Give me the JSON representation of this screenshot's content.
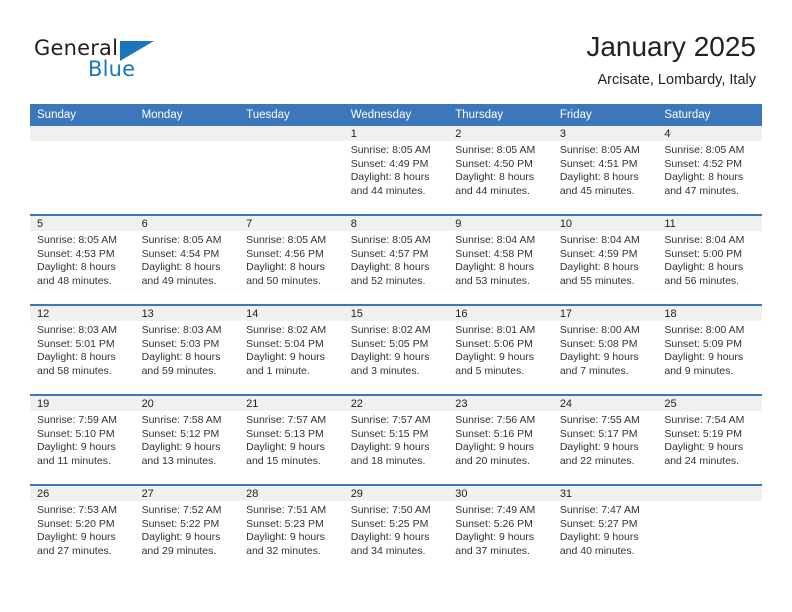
{
  "brand": {
    "line1": "General",
    "line2": "Blue",
    "flag_icon": "triangle-flag-icon",
    "accent_color": "#1b75bb"
  },
  "header": {
    "title": "January 2025",
    "subtitle": "Arcisate, Lombardy, Italy"
  },
  "theme": {
    "header_row_bg": "#3b77ba",
    "daynum_band_bg": "#f0f0f0",
    "row_divider": "#3b77ba"
  },
  "calendar": {
    "weekday_headers": [
      "Sunday",
      "Monday",
      "Tuesday",
      "Wednesday",
      "Thursday",
      "Friday",
      "Saturday"
    ],
    "weeks": [
      [
        {
          "day": "",
          "empty": true,
          "sunrise": "",
          "sunset": "",
          "daylight1": "",
          "daylight2": ""
        },
        {
          "day": "",
          "empty": true,
          "sunrise": "",
          "sunset": "",
          "daylight1": "",
          "daylight2": ""
        },
        {
          "day": "",
          "empty": true,
          "sunrise": "",
          "sunset": "",
          "daylight1": "",
          "daylight2": ""
        },
        {
          "day": "1",
          "empty": false,
          "sunrise": "Sunrise: 8:05 AM",
          "sunset": "Sunset: 4:49 PM",
          "daylight1": "Daylight: 8 hours",
          "daylight2": "and 44 minutes."
        },
        {
          "day": "2",
          "empty": false,
          "sunrise": "Sunrise: 8:05 AM",
          "sunset": "Sunset: 4:50 PM",
          "daylight1": "Daylight: 8 hours",
          "daylight2": "and 44 minutes."
        },
        {
          "day": "3",
          "empty": false,
          "sunrise": "Sunrise: 8:05 AM",
          "sunset": "Sunset: 4:51 PM",
          "daylight1": "Daylight: 8 hours",
          "daylight2": "and 45 minutes."
        },
        {
          "day": "4",
          "empty": false,
          "sunrise": "Sunrise: 8:05 AM",
          "sunset": "Sunset: 4:52 PM",
          "daylight1": "Daylight: 8 hours",
          "daylight2": "and 47 minutes."
        }
      ],
      [
        {
          "day": "5",
          "empty": false,
          "sunrise": "Sunrise: 8:05 AM",
          "sunset": "Sunset: 4:53 PM",
          "daylight1": "Daylight: 8 hours",
          "daylight2": "and 48 minutes."
        },
        {
          "day": "6",
          "empty": false,
          "sunrise": "Sunrise: 8:05 AM",
          "sunset": "Sunset: 4:54 PM",
          "daylight1": "Daylight: 8 hours",
          "daylight2": "and 49 minutes."
        },
        {
          "day": "7",
          "empty": false,
          "sunrise": "Sunrise: 8:05 AM",
          "sunset": "Sunset: 4:56 PM",
          "daylight1": "Daylight: 8 hours",
          "daylight2": "and 50 minutes."
        },
        {
          "day": "8",
          "empty": false,
          "sunrise": "Sunrise: 8:05 AM",
          "sunset": "Sunset: 4:57 PM",
          "daylight1": "Daylight: 8 hours",
          "daylight2": "and 52 minutes."
        },
        {
          "day": "9",
          "empty": false,
          "sunrise": "Sunrise: 8:04 AM",
          "sunset": "Sunset: 4:58 PM",
          "daylight1": "Daylight: 8 hours",
          "daylight2": "and 53 minutes."
        },
        {
          "day": "10",
          "empty": false,
          "sunrise": "Sunrise: 8:04 AM",
          "sunset": "Sunset: 4:59 PM",
          "daylight1": "Daylight: 8 hours",
          "daylight2": "and 55 minutes."
        },
        {
          "day": "11",
          "empty": false,
          "sunrise": "Sunrise: 8:04 AM",
          "sunset": "Sunset: 5:00 PM",
          "daylight1": "Daylight: 8 hours",
          "daylight2": "and 56 minutes."
        }
      ],
      [
        {
          "day": "12",
          "empty": false,
          "sunrise": "Sunrise: 8:03 AM",
          "sunset": "Sunset: 5:01 PM",
          "daylight1": "Daylight: 8 hours",
          "daylight2": "and 58 minutes."
        },
        {
          "day": "13",
          "empty": false,
          "sunrise": "Sunrise: 8:03 AM",
          "sunset": "Sunset: 5:03 PM",
          "daylight1": "Daylight: 8 hours",
          "daylight2": "and 59 minutes."
        },
        {
          "day": "14",
          "empty": false,
          "sunrise": "Sunrise: 8:02 AM",
          "sunset": "Sunset: 5:04 PM",
          "daylight1": "Daylight: 9 hours",
          "daylight2": "and 1 minute."
        },
        {
          "day": "15",
          "empty": false,
          "sunrise": "Sunrise: 8:02 AM",
          "sunset": "Sunset: 5:05 PM",
          "daylight1": "Daylight: 9 hours",
          "daylight2": "and 3 minutes."
        },
        {
          "day": "16",
          "empty": false,
          "sunrise": "Sunrise: 8:01 AM",
          "sunset": "Sunset: 5:06 PM",
          "daylight1": "Daylight: 9 hours",
          "daylight2": "and 5 minutes."
        },
        {
          "day": "17",
          "empty": false,
          "sunrise": "Sunrise: 8:00 AM",
          "sunset": "Sunset: 5:08 PM",
          "daylight1": "Daylight: 9 hours",
          "daylight2": "and 7 minutes."
        },
        {
          "day": "18",
          "empty": false,
          "sunrise": "Sunrise: 8:00 AM",
          "sunset": "Sunset: 5:09 PM",
          "daylight1": "Daylight: 9 hours",
          "daylight2": "and 9 minutes."
        }
      ],
      [
        {
          "day": "19",
          "empty": false,
          "sunrise": "Sunrise: 7:59 AM",
          "sunset": "Sunset: 5:10 PM",
          "daylight1": "Daylight: 9 hours",
          "daylight2": "and 11 minutes."
        },
        {
          "day": "20",
          "empty": false,
          "sunrise": "Sunrise: 7:58 AM",
          "sunset": "Sunset: 5:12 PM",
          "daylight1": "Daylight: 9 hours",
          "daylight2": "and 13 minutes."
        },
        {
          "day": "21",
          "empty": false,
          "sunrise": "Sunrise: 7:57 AM",
          "sunset": "Sunset: 5:13 PM",
          "daylight1": "Daylight: 9 hours",
          "daylight2": "and 15 minutes."
        },
        {
          "day": "22",
          "empty": false,
          "sunrise": "Sunrise: 7:57 AM",
          "sunset": "Sunset: 5:15 PM",
          "daylight1": "Daylight: 9 hours",
          "daylight2": "and 18 minutes."
        },
        {
          "day": "23",
          "empty": false,
          "sunrise": "Sunrise: 7:56 AM",
          "sunset": "Sunset: 5:16 PM",
          "daylight1": "Daylight: 9 hours",
          "daylight2": "and 20 minutes."
        },
        {
          "day": "24",
          "empty": false,
          "sunrise": "Sunrise: 7:55 AM",
          "sunset": "Sunset: 5:17 PM",
          "daylight1": "Daylight: 9 hours",
          "daylight2": "and 22 minutes."
        },
        {
          "day": "25",
          "empty": false,
          "sunrise": "Sunrise: 7:54 AM",
          "sunset": "Sunset: 5:19 PM",
          "daylight1": "Daylight: 9 hours",
          "daylight2": "and 24 minutes."
        }
      ],
      [
        {
          "day": "26",
          "empty": false,
          "sunrise": "Sunrise: 7:53 AM",
          "sunset": "Sunset: 5:20 PM",
          "daylight1": "Daylight: 9 hours",
          "daylight2": "and 27 minutes."
        },
        {
          "day": "27",
          "empty": false,
          "sunrise": "Sunrise: 7:52 AM",
          "sunset": "Sunset: 5:22 PM",
          "daylight1": "Daylight: 9 hours",
          "daylight2": "and 29 minutes."
        },
        {
          "day": "28",
          "empty": false,
          "sunrise": "Sunrise: 7:51 AM",
          "sunset": "Sunset: 5:23 PM",
          "daylight1": "Daylight: 9 hours",
          "daylight2": "and 32 minutes."
        },
        {
          "day": "29",
          "empty": false,
          "sunrise": "Sunrise: 7:50 AM",
          "sunset": "Sunset: 5:25 PM",
          "daylight1": "Daylight: 9 hours",
          "daylight2": "and 34 minutes."
        },
        {
          "day": "30",
          "empty": false,
          "sunrise": "Sunrise: 7:49 AM",
          "sunset": "Sunset: 5:26 PM",
          "daylight1": "Daylight: 9 hours",
          "daylight2": "and 37 minutes."
        },
        {
          "day": "31",
          "empty": false,
          "sunrise": "Sunrise: 7:47 AM",
          "sunset": "Sunset: 5:27 PM",
          "daylight1": "Daylight: 9 hours",
          "daylight2": "and 40 minutes."
        },
        {
          "day": "",
          "empty": true,
          "sunrise": "",
          "sunset": "",
          "daylight1": "",
          "daylight2": ""
        }
      ]
    ]
  }
}
